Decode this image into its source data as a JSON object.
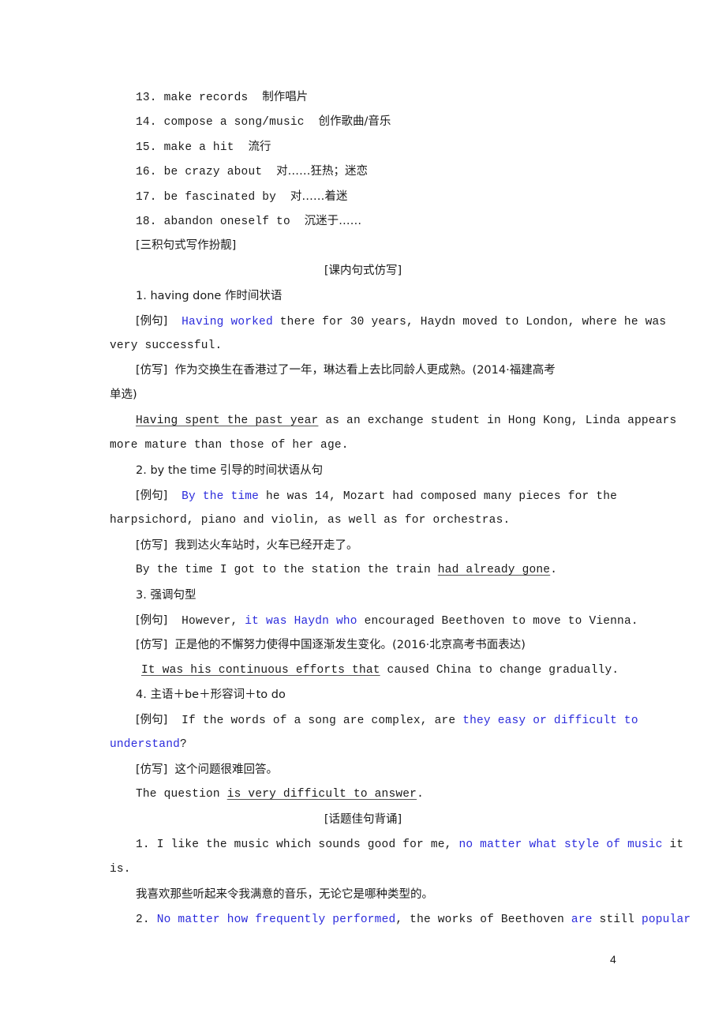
{
  "vocab": [
    {
      "num": "13.",
      "en": "make records",
      "cn": "制作唱片"
    },
    {
      "num": "14.",
      "en": "compose a song/music",
      "cn": "创作歌曲/音乐"
    },
    {
      "num": "15.",
      "en": "make a hit",
      "cn": "流行"
    },
    {
      "num": "16.",
      "en": "be crazy about",
      "cn": "对……狂热；迷恋"
    },
    {
      "num": "17.",
      "en": "be fascinated by",
      "cn": "对……着迷"
    },
    {
      "num": "18.",
      "en": "abandon oneself to",
      "cn": "沉迷于……"
    }
  ],
  "section_title": "[三积句式写作扮靓]",
  "subsection1": "[课内句式仿写]",
  "patterns": [
    {
      "title": "1. having done 作时间状语",
      "example_tag": "[例句]",
      "example_hl": "Having worked",
      "example_rest1": " there for 30 years, Haydn moved to London, where he was",
      "example_rest2": "very successful.",
      "imit_tag": "[仿写]",
      "imit_cn1": "作为交换生在香港过了一年，琳达看上去比同龄人更成熟。(2014·福建高考",
      "imit_cn2": "单选)",
      "answer_ul": "Having spent the past year",
      "answer_rest1": " as an exchange student in Hong Kong, Linda appears",
      "answer_rest2": "more mature than those of her age."
    },
    {
      "title": "2. by the time 引导的时间状语从句",
      "example_tag": "[例句]",
      "example_hl": "By the time",
      "example_rest1": " he was 14,  Mozart had composed many pieces for the",
      "example_rest2": "harpsichord, piano and violin, as well as for orchestras.",
      "imit_tag": "[仿写]",
      "imit_cn1": "我到达火车站时，火车已经开走了。",
      "answer_pre": "By the time I got to the station the train ",
      "answer_ul": "had already gone",
      "answer_post": "."
    },
    {
      "title": "3. 强调句型",
      "example_tag": "[例句]",
      "example_pre": "However, ",
      "example_hl": "it was Haydn who",
      "example_post": " encouraged Beethoven to move to Vienna.",
      "imit_tag": "[仿写]",
      "imit_cn1": "正是他的不懈努力使得中国逐渐发生变化。(2016·北京高考书面表达)",
      "answer_ul": "It was his continuous efforts that",
      "answer_post": " caused China to change gradually."
    },
    {
      "title": "4. 主语＋be＋形容词＋to do",
      "example_tag": "[例句]",
      "example_pre": "If the words of a song are complex, are ",
      "example_hl": "they easy or difficult to",
      "example_hl2": "understand",
      "example_post2": "?",
      "imit_tag": "[仿写]",
      "imit_cn1": "这个问题很难回答。",
      "answer_pre": "The question ",
      "answer_ul": "is very difficult to answer",
      "answer_post": "."
    }
  ],
  "subsection2": "[话题佳句背诵]",
  "topic_sentences": [
    {
      "pre": "1. I like the music which sounds good for me, ",
      "hl": "no matter what style of music",
      "post": " it",
      "line2": "is.",
      "cn": "我喜欢那些听起来令我满意的音乐，无论它是哪种类型的。"
    },
    {
      "num": "2. ",
      "hl": "No matter how frequently performed",
      "mid": ", the works of Beethoven ",
      "hl2": "are",
      "mid2": " still ",
      "hl3": "popular"
    }
  ],
  "page_number": "4",
  "colors": {
    "highlight": "#2b2bdc",
    "text": "#1a1a1a"
  }
}
